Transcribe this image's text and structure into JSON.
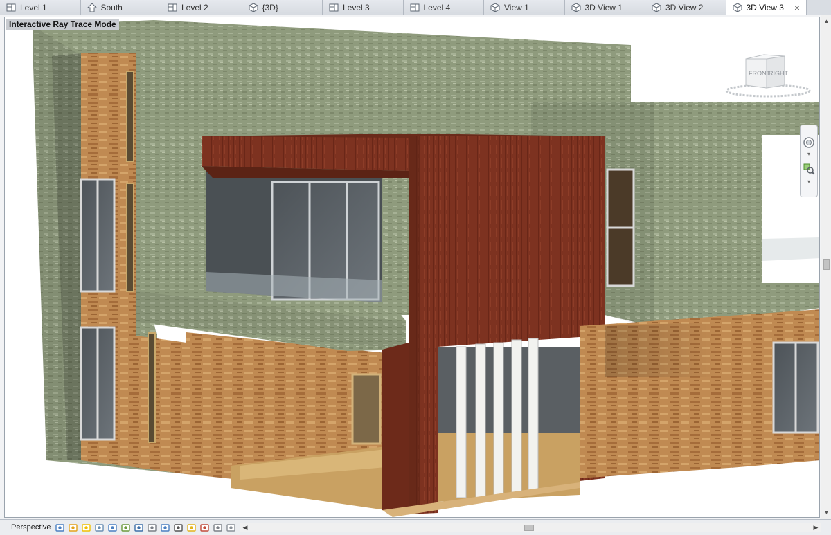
{
  "tabs": [
    {
      "label": "Level 1",
      "icon": "floor-plan-icon",
      "active": false
    },
    {
      "label": "South",
      "icon": "elevation-icon",
      "active": false
    },
    {
      "label": "Level 2",
      "icon": "floor-plan-icon",
      "active": false
    },
    {
      "label": "{3D}",
      "icon": "3d-view-icon",
      "active": false
    },
    {
      "label": "Level 3",
      "icon": "floor-plan-icon",
      "active": false
    },
    {
      "label": "Level 4",
      "icon": "floor-plan-icon",
      "active": false
    },
    {
      "label": "View 1",
      "icon": "3d-view-icon",
      "active": false
    },
    {
      "label": "3D View 1",
      "icon": "3d-view-icon",
      "active": false
    },
    {
      "label": "3D View 2",
      "icon": "3d-view-icon",
      "active": false
    },
    {
      "label": "3D View 3",
      "icon": "3d-view-icon",
      "active": true
    }
  ],
  "tab_close": "×",
  "viewport": {
    "mode_label": "Interactive Ray Trace Mode",
    "viewcube": {
      "front": "FRONT",
      "right": "RIGHT"
    }
  },
  "view_control_bar": {
    "view_type": "Perspective",
    "icons": [
      "visual-style-icon",
      "sun-path-icon",
      "shadows-icon",
      "render-icon",
      "crop-view-icon",
      "show-crop-icon",
      "unlock-3d-icon",
      "temporary-hide-icon",
      "reveal-hidden-icon",
      "worksharing-icon",
      "lightbulb-icon",
      "analysis-icon",
      "highlight-icon",
      "constraints-icon"
    ]
  },
  "colors": {
    "brick_orange": "#b8824a",
    "stucco_green": "#8e9a7a",
    "accent_red": "#7a2e1e",
    "glass": "#5a6066",
    "floor_wood": "#c59a5a"
  }
}
